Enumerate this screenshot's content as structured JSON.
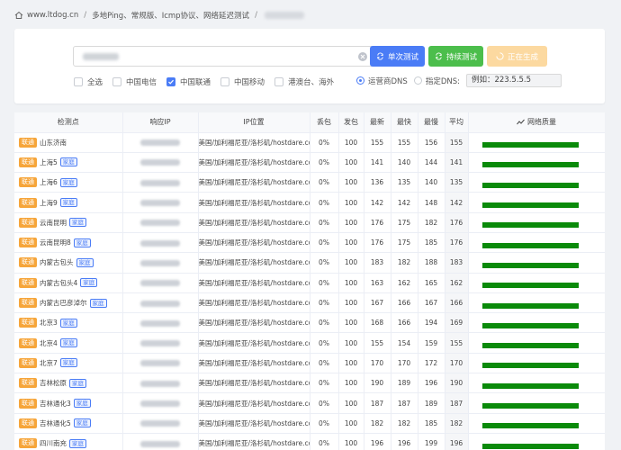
{
  "breadcrumb": {
    "site": "www.ltdog.cn",
    "section": "多地Ping、常规版、Icmp协议、网络延迟测试"
  },
  "controls": {
    "btn_single": "单次测试",
    "btn_continuous": "持续测试",
    "btn_generating": "正在生成",
    "checkboxes": [
      {
        "label": "全选",
        "checked": false
      },
      {
        "label": "中国电信",
        "checked": false
      },
      {
        "label": "中国联通",
        "checked": true
      },
      {
        "label": "中国移动",
        "checked": false
      },
      {
        "label": "港澳台、海外",
        "checked": false
      }
    ],
    "radio_isp": "运营商DNS",
    "radio_custom": "指定DNS:",
    "dns_placeholder": "例如：223.5.5.5"
  },
  "table": {
    "headers": [
      "检测点",
      "响应IP",
      "IP位置",
      "丢包",
      "发包",
      "最新",
      "最快",
      "最慢",
      "平均",
      "网络质量"
    ],
    "rows": [
      {
        "isp": "联通",
        "loc": "山东济南",
        "home": "",
        "ip_loc": "美国/加利福尼亚/洛杉矶/hostdare.com",
        "loss": "0%",
        "sent": "100",
        "latest": "155",
        "fast": "155",
        "slow": "156",
        "avg": "155",
        "quality": 1.0
      },
      {
        "isp": "联通",
        "loc": "上海5",
        "home": "家庭",
        "ip_loc": "美国/加利福尼亚/洛杉矶/hostdare.com",
        "loss": "0%",
        "sent": "100",
        "latest": "141",
        "fast": "140",
        "slow": "144",
        "avg": "141",
        "quality": 1.0
      },
      {
        "isp": "联通",
        "loc": "上海6",
        "home": "家庭",
        "ip_loc": "美国/加利福尼亚/洛杉矶/hostdare.com",
        "loss": "0%",
        "sent": "100",
        "latest": "136",
        "fast": "135",
        "slow": "140",
        "avg": "135",
        "quality": 1.0
      },
      {
        "isp": "联通",
        "loc": "上海9",
        "home": "家庭",
        "ip_loc": "美国/加利福尼亚/洛杉矶/hostdare.com",
        "loss": "0%",
        "sent": "100",
        "latest": "142",
        "fast": "142",
        "slow": "148",
        "avg": "142",
        "quality": 1.0
      },
      {
        "isp": "联通",
        "loc": "云南昆明",
        "home": "家庭",
        "ip_loc": "美国/加利福尼亚/洛杉矶/hostdare.com",
        "loss": "0%",
        "sent": "100",
        "latest": "176",
        "fast": "175",
        "slow": "182",
        "avg": "176",
        "quality": 1.0
      },
      {
        "isp": "联通",
        "loc": "云南昆明8",
        "home": "家庭",
        "ip_loc": "美国/加利福尼亚/洛杉矶/hostdare.com",
        "loss": "0%",
        "sent": "100",
        "latest": "176",
        "fast": "175",
        "slow": "185",
        "avg": "176",
        "quality": 1.0
      },
      {
        "isp": "联通",
        "loc": "内蒙古包头",
        "home": "家庭",
        "ip_loc": "美国/加利福尼亚/洛杉矶/hostdare.com",
        "loss": "0%",
        "sent": "100",
        "latest": "183",
        "fast": "182",
        "slow": "188",
        "avg": "183",
        "quality": 1.0
      },
      {
        "isp": "联通",
        "loc": "内蒙古包头4",
        "home": "家庭",
        "ip_loc": "美国/加利福尼亚/洛杉矶/hostdare.com",
        "loss": "0%",
        "sent": "100",
        "latest": "163",
        "fast": "162",
        "slow": "165",
        "avg": "162",
        "quality": 1.0
      },
      {
        "isp": "联通",
        "loc": "内蒙古巴彦淖尔",
        "home": "家庭",
        "ip_loc": "美国/加利福尼亚/洛杉矶/hostdare.com",
        "loss": "0%",
        "sent": "100",
        "latest": "167",
        "fast": "166",
        "slow": "167",
        "avg": "166",
        "quality": 1.0
      },
      {
        "isp": "联通",
        "loc": "北京3",
        "home": "家庭",
        "ip_loc": "美国/加利福尼亚/洛杉矶/hostdare.com",
        "loss": "0%",
        "sent": "100",
        "latest": "168",
        "fast": "166",
        "slow": "194",
        "avg": "169",
        "quality": 1.0
      },
      {
        "isp": "联通",
        "loc": "北京4",
        "home": "家庭",
        "ip_loc": "美国/加利福尼亚/洛杉矶/hostdare.com",
        "loss": "0%",
        "sent": "100",
        "latest": "155",
        "fast": "154",
        "slow": "159",
        "avg": "155",
        "quality": 1.0
      },
      {
        "isp": "联通",
        "loc": "北京7",
        "home": "家庭",
        "ip_loc": "美国/加利福尼亚/洛杉矶/hostdare.com",
        "loss": "0%",
        "sent": "100",
        "latest": "170",
        "fast": "170",
        "slow": "172",
        "avg": "170",
        "quality": 1.0
      },
      {
        "isp": "联通",
        "loc": "吉林松原",
        "home": "家庭",
        "ip_loc": "美国/加利福尼亚/洛杉矶/hostdare.com",
        "loss": "0%",
        "sent": "100",
        "latest": "190",
        "fast": "189",
        "slow": "196",
        "avg": "190",
        "quality": 1.0
      },
      {
        "isp": "联通",
        "loc": "吉林通化3",
        "home": "家庭",
        "ip_loc": "美国/加利福尼亚/洛杉矶/hostdare.com",
        "loss": "0%",
        "sent": "100",
        "latest": "187",
        "fast": "187",
        "slow": "189",
        "avg": "187",
        "quality": 1.0
      },
      {
        "isp": "联通",
        "loc": "吉林通化5",
        "home": "家庭",
        "ip_loc": "美国/加利福尼亚/洛杉矶/hostdare.com",
        "loss": "0%",
        "sent": "100",
        "latest": "182",
        "fast": "182",
        "slow": "185",
        "avg": "182",
        "quality": 1.0
      },
      {
        "isp": "联通",
        "loc": "四川南充",
        "home": "家庭",
        "ip_loc": "美国/加利福尼亚/洛杉矶/hostdare.com",
        "loss": "0%",
        "sent": "100",
        "latest": "196",
        "fast": "196",
        "slow": "199",
        "avg": "196",
        "quality": 1.0
      }
    ]
  }
}
